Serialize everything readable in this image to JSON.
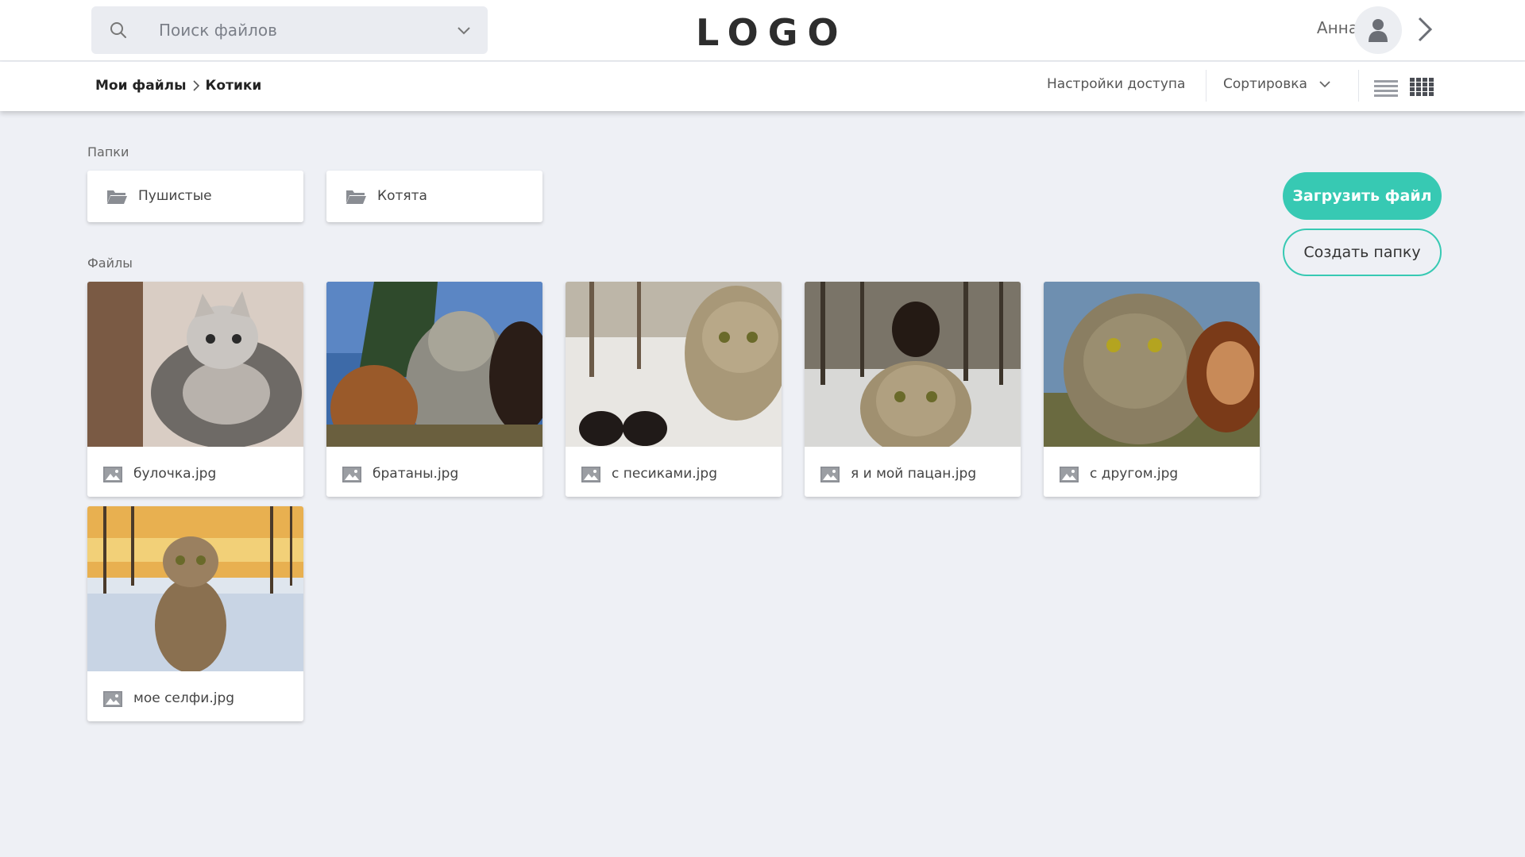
{
  "header": {
    "search_placeholder": "Поиск файлов",
    "logo": "LOGO",
    "user_name": "Анна"
  },
  "toolbar": {
    "breadcrumb": [
      "Мои файлы",
      "Котики"
    ],
    "access_label": "Настройки доступа",
    "sort_label": "Сортировка",
    "active_view": "grid"
  },
  "folders_section": {
    "title": "Папки",
    "items": [
      {
        "name": "Пушистые"
      },
      {
        "name": "Котята"
      }
    ]
  },
  "files_section": {
    "title": "Файлы",
    "items": [
      {
        "name": "булочка.jpg"
      },
      {
        "name": "братаны.jpg"
      },
      {
        "name": "с песиками.jpg"
      },
      {
        "name": "я и мой пацан.jpg"
      },
      {
        "name": "с другом.jpg"
      },
      {
        "name": "мое селфи.jpg"
      }
    ]
  },
  "actions": {
    "upload_label": "Загрузить файл",
    "create_folder_label": "Создать папку"
  },
  "colors": {
    "accent": "#37c9b3",
    "background": "#eef0f5"
  }
}
